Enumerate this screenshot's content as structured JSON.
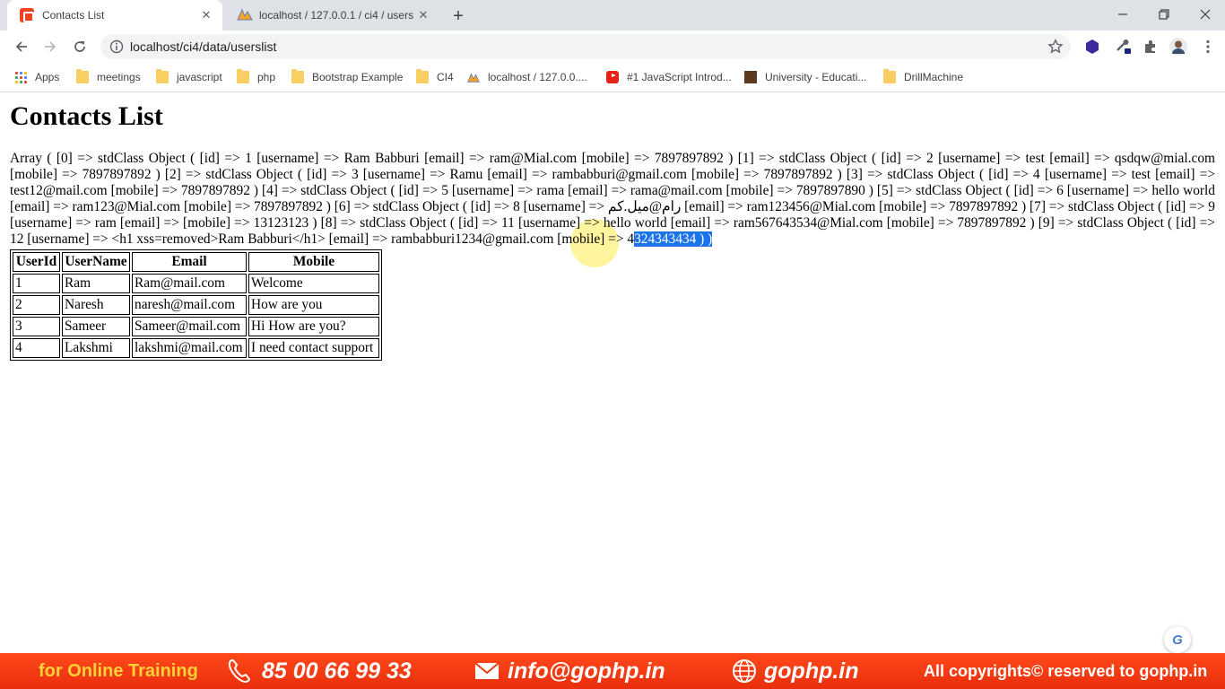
{
  "browser": {
    "tabs": [
      {
        "title": "Contacts List",
        "active": true,
        "favicon": "codeigniter-icon"
      },
      {
        "title": "localhost / 127.0.0.1 / ci4 / users",
        "active": false,
        "favicon": "phpmyadmin-icon"
      }
    ],
    "url": "localhost/ci4/data/userslist"
  },
  "bookmarks": [
    {
      "label": "Apps",
      "icon": "apps-grid-icon"
    },
    {
      "label": "meetings",
      "icon": "folder-icon"
    },
    {
      "label": "javascript",
      "icon": "folder-icon"
    },
    {
      "label": "php",
      "icon": "folder-icon"
    },
    {
      "label": "Bootstrap Example",
      "icon": "folder-icon"
    },
    {
      "label": "CI4",
      "icon": "folder-icon"
    },
    {
      "label": "localhost / 127.0.0....",
      "icon": "phpmyadmin-icon"
    },
    {
      "label": "#1 JavaScript Introd...",
      "icon": "youtube-icon"
    },
    {
      "label": "University - Educati...",
      "icon": "university-icon"
    },
    {
      "label": "DrillMachine",
      "icon": "folder-icon"
    }
  ],
  "page": {
    "heading": "Contacts List",
    "dump_text": "Array ( [0] => stdClass Object ( [id] => 1 [username] => Ram Babburi [email] => ram@Mial.com [mobile] => 7897897892 ) [1] => stdClass Object ( [id] => 2 [username] => test [email] => qsdqw@mial.com [mobile] => 7897897892 ) [2] => stdClass Object ( [id] => 3 [username] => Ramu [email] => rambabburi@gmail.com [mobile] => 7897897892 ) [3] => stdClass Object ( [id] => 4 [username] => test [email] => test12@mail.com [mobile] => 7897897892 ) [4] => stdClass Object ( [id] => 5 [username] => rama [email] => rama@mail.com [mobile] => 7897897890 ) [5] => stdClass Object ( [id] => 6 [username] => hello world [email] => ram123@Mial.com [mobile] => 7897897892 ) [6] => stdClass Object ( [id] => 8 [username] => رام@میل.کم [email] => ram123456@Mial.com [mobile] => 7897897892 ) [7] => stdClass Object ( [id] => 9 [username] => ram [email] => [mobile] => 13123123 ) [8] => stdClass Object ( [id] => 11 [username] => hello world [email] => ram567643534@Mial.com [mobile] => 7897897892 ) [9] => stdClass Object ( [id] => 12 [username] => <h1 xss=removed>Ram Babburi</h1> [email] => rambabburi1234@gmail.com [mobile] => 4",
    "dump_selected": "324343434 ) )",
    "table": {
      "headers": [
        "UserId",
        "UserName",
        "Email",
        "Mobile"
      ],
      "rows": [
        [
          "1",
          "Ram",
          "Ram@mail.com",
          "Welcome"
        ],
        [
          "2",
          "Naresh",
          "naresh@mail.com",
          "How are you"
        ],
        [
          "3",
          "Sameer",
          "Sameer@mail.com",
          "Hi How are you?"
        ],
        [
          "4",
          "Lakshmi",
          "lakshmi@mail.com",
          "I need contact support"
        ]
      ]
    },
    "badge": "G"
  },
  "banner": {
    "training": "for Online Training",
    "phone": "85 00 66 99 33",
    "email": "info@gophp.in",
    "site": "gophp.in",
    "copyright": "All copyrights© reserved to gophp.in"
  },
  "colors": {
    "tab_strip": "#dee1e6",
    "banner": "#f03a10",
    "selection": "#1a73e8"
  }
}
